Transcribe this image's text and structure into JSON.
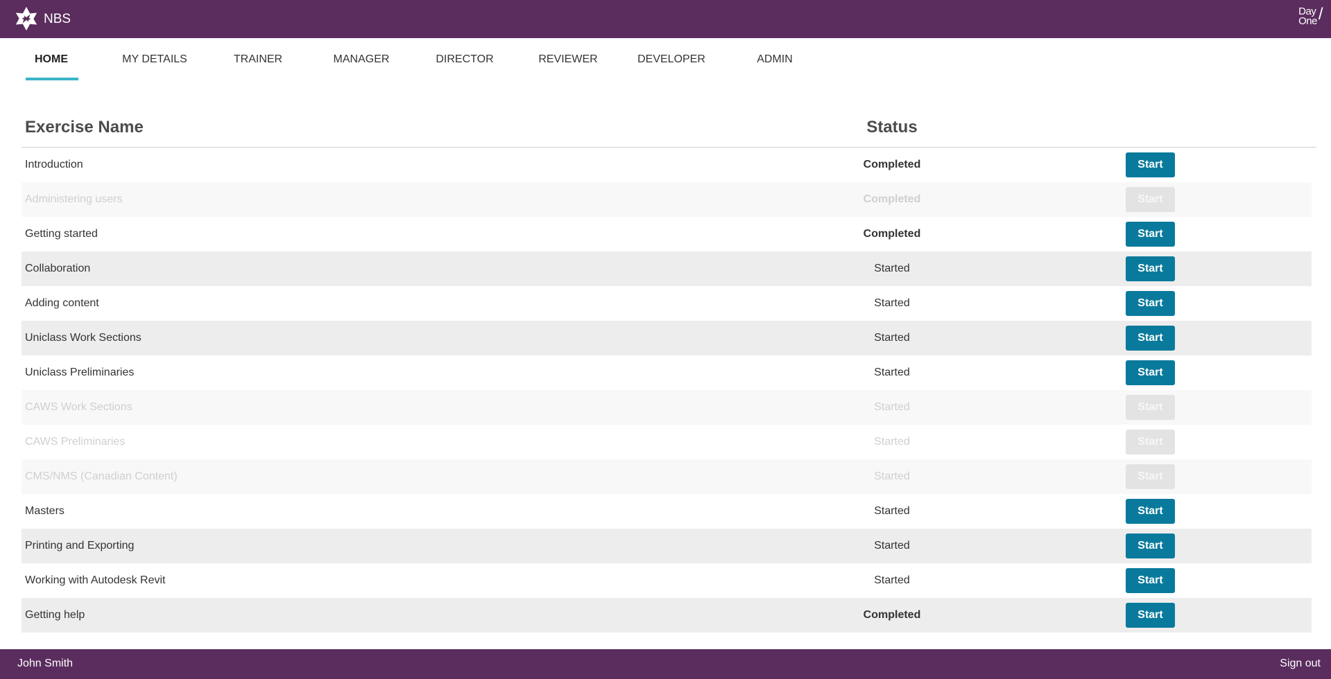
{
  "header": {
    "brand": "NBS",
    "logo_icon": "nbs-star-logo-icon",
    "partner_logo": {
      "line1": "Day",
      "line2": "One",
      "mark": "/"
    },
    "bar_color": "#5a2d5e"
  },
  "nav": {
    "items": [
      {
        "label": "HOME",
        "active": true
      },
      {
        "label": "MY DETAILS",
        "active": false
      },
      {
        "label": "TRAINER",
        "active": false
      },
      {
        "label": "MANAGER",
        "active": false
      },
      {
        "label": "DIRECTOR",
        "active": false
      },
      {
        "label": "REVIEWER",
        "active": false
      },
      {
        "label": "DEVELOPER",
        "active": false
      },
      {
        "label": "ADMIN",
        "active": false
      }
    ],
    "active_underline_color": "#3ab4c8"
  },
  "table": {
    "headers": {
      "name": "Exercise Name",
      "status": "Status"
    },
    "button_color": "#0a7a9c",
    "rows": [
      {
        "name": "Introduction",
        "status": "Completed",
        "action": "Start",
        "enabled": true
      },
      {
        "name": "Administering users",
        "status": "Completed",
        "action": "Start",
        "enabled": false
      },
      {
        "name": "Getting started",
        "status": "Completed",
        "action": "Start",
        "enabled": true
      },
      {
        "name": "Collaboration",
        "status": "Started",
        "action": "Start",
        "enabled": true
      },
      {
        "name": "Adding content",
        "status": "Started",
        "action": "Start",
        "enabled": true
      },
      {
        "name": "Uniclass Work Sections",
        "status": "Started",
        "action": "Start",
        "enabled": true
      },
      {
        "name": "Uniclass Preliminaries",
        "status": "Started",
        "action": "Start",
        "enabled": true
      },
      {
        "name": "CAWS Work Sections",
        "status": "Started",
        "action": "Start",
        "enabled": false
      },
      {
        "name": "CAWS Preliminaries",
        "status": "Started",
        "action": "Start",
        "enabled": false
      },
      {
        "name": "CMS/NMS (Canadian Content)",
        "status": "Started",
        "action": "Start",
        "enabled": false
      },
      {
        "name": "Masters",
        "status": "Started",
        "action": "Start",
        "enabled": true
      },
      {
        "name": "Printing and Exporting",
        "status": "Started",
        "action": "Start",
        "enabled": true
      },
      {
        "name": "Working with Autodesk Revit",
        "status": "Started",
        "action": "Start",
        "enabled": true
      },
      {
        "name": "Getting help",
        "status": "Completed",
        "action": "Start",
        "enabled": true
      }
    ]
  },
  "footer": {
    "user_name": "John Smith",
    "sign_out_label": "Sign out"
  }
}
